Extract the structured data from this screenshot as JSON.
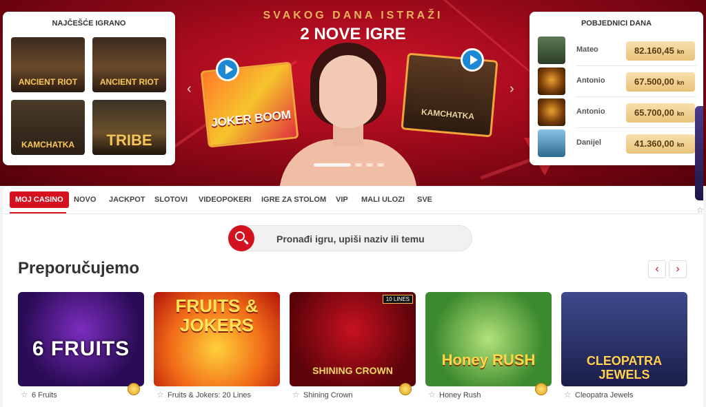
{
  "hero": {
    "subtitle": "SVAKOG DANA ISTRAŽI",
    "title": "2 NOVE IGRE",
    "promo_left": "JOKER BOOM",
    "promo_right": "KAMCHATKA",
    "arrow_prev": "‹",
    "arrow_next": "›"
  },
  "most_played": {
    "title": "NAJČEŠĆE IGRANO",
    "tiles": [
      {
        "label": "ANCIENT RIOT"
      },
      {
        "label": "ANCIENT RIOT"
      },
      {
        "label": "KAMCHATKA"
      },
      {
        "label": "TRIBE"
      }
    ]
  },
  "winners": {
    "title": "POBJEDNICI DANA",
    "items": [
      {
        "name": "Mateo",
        "amount": "82.160,45",
        "currency": "kn"
      },
      {
        "name": "Antonio",
        "amount": "67.500,00",
        "currency": "kn"
      },
      {
        "name": "Antonio",
        "amount": "65.700,00",
        "currency": "kn"
      },
      {
        "name": "Danijel",
        "amount": "41.360,00",
        "currency": "kn"
      }
    ]
  },
  "tabs": [
    "MOJ CASINO",
    "NOVO",
    "JACKPOT",
    "SLOTOVI",
    "VIDEOPOKERI",
    "IGRE ZA STOLOM",
    "VIP",
    "MALI ULOZI",
    "SVE"
  ],
  "search": {
    "placeholder": "Pronađi igru, upiši naziv ili temu"
  },
  "recommended": {
    "title": "Preporučujemo",
    "prev": "‹",
    "next": "›",
    "games": [
      {
        "name": "6 Fruits",
        "logo": "6 FRUITS"
      },
      {
        "name": "Fruits & Jokers: 20 Lines",
        "logo": "FRUITS & JOKERS"
      },
      {
        "name": "Shining Crown",
        "logo": "SHINING CROWN",
        "badge": "10 LINES"
      },
      {
        "name": "Honey Rush",
        "logo": "Honey RUSH"
      },
      {
        "name": "Cleopatra Jewels",
        "logo": "CLEOPATRA JEWELS"
      }
    ]
  },
  "colors": {
    "accent": "#d3111f",
    "hero_red": "#a40b1c",
    "gold": "#e9c27a"
  }
}
